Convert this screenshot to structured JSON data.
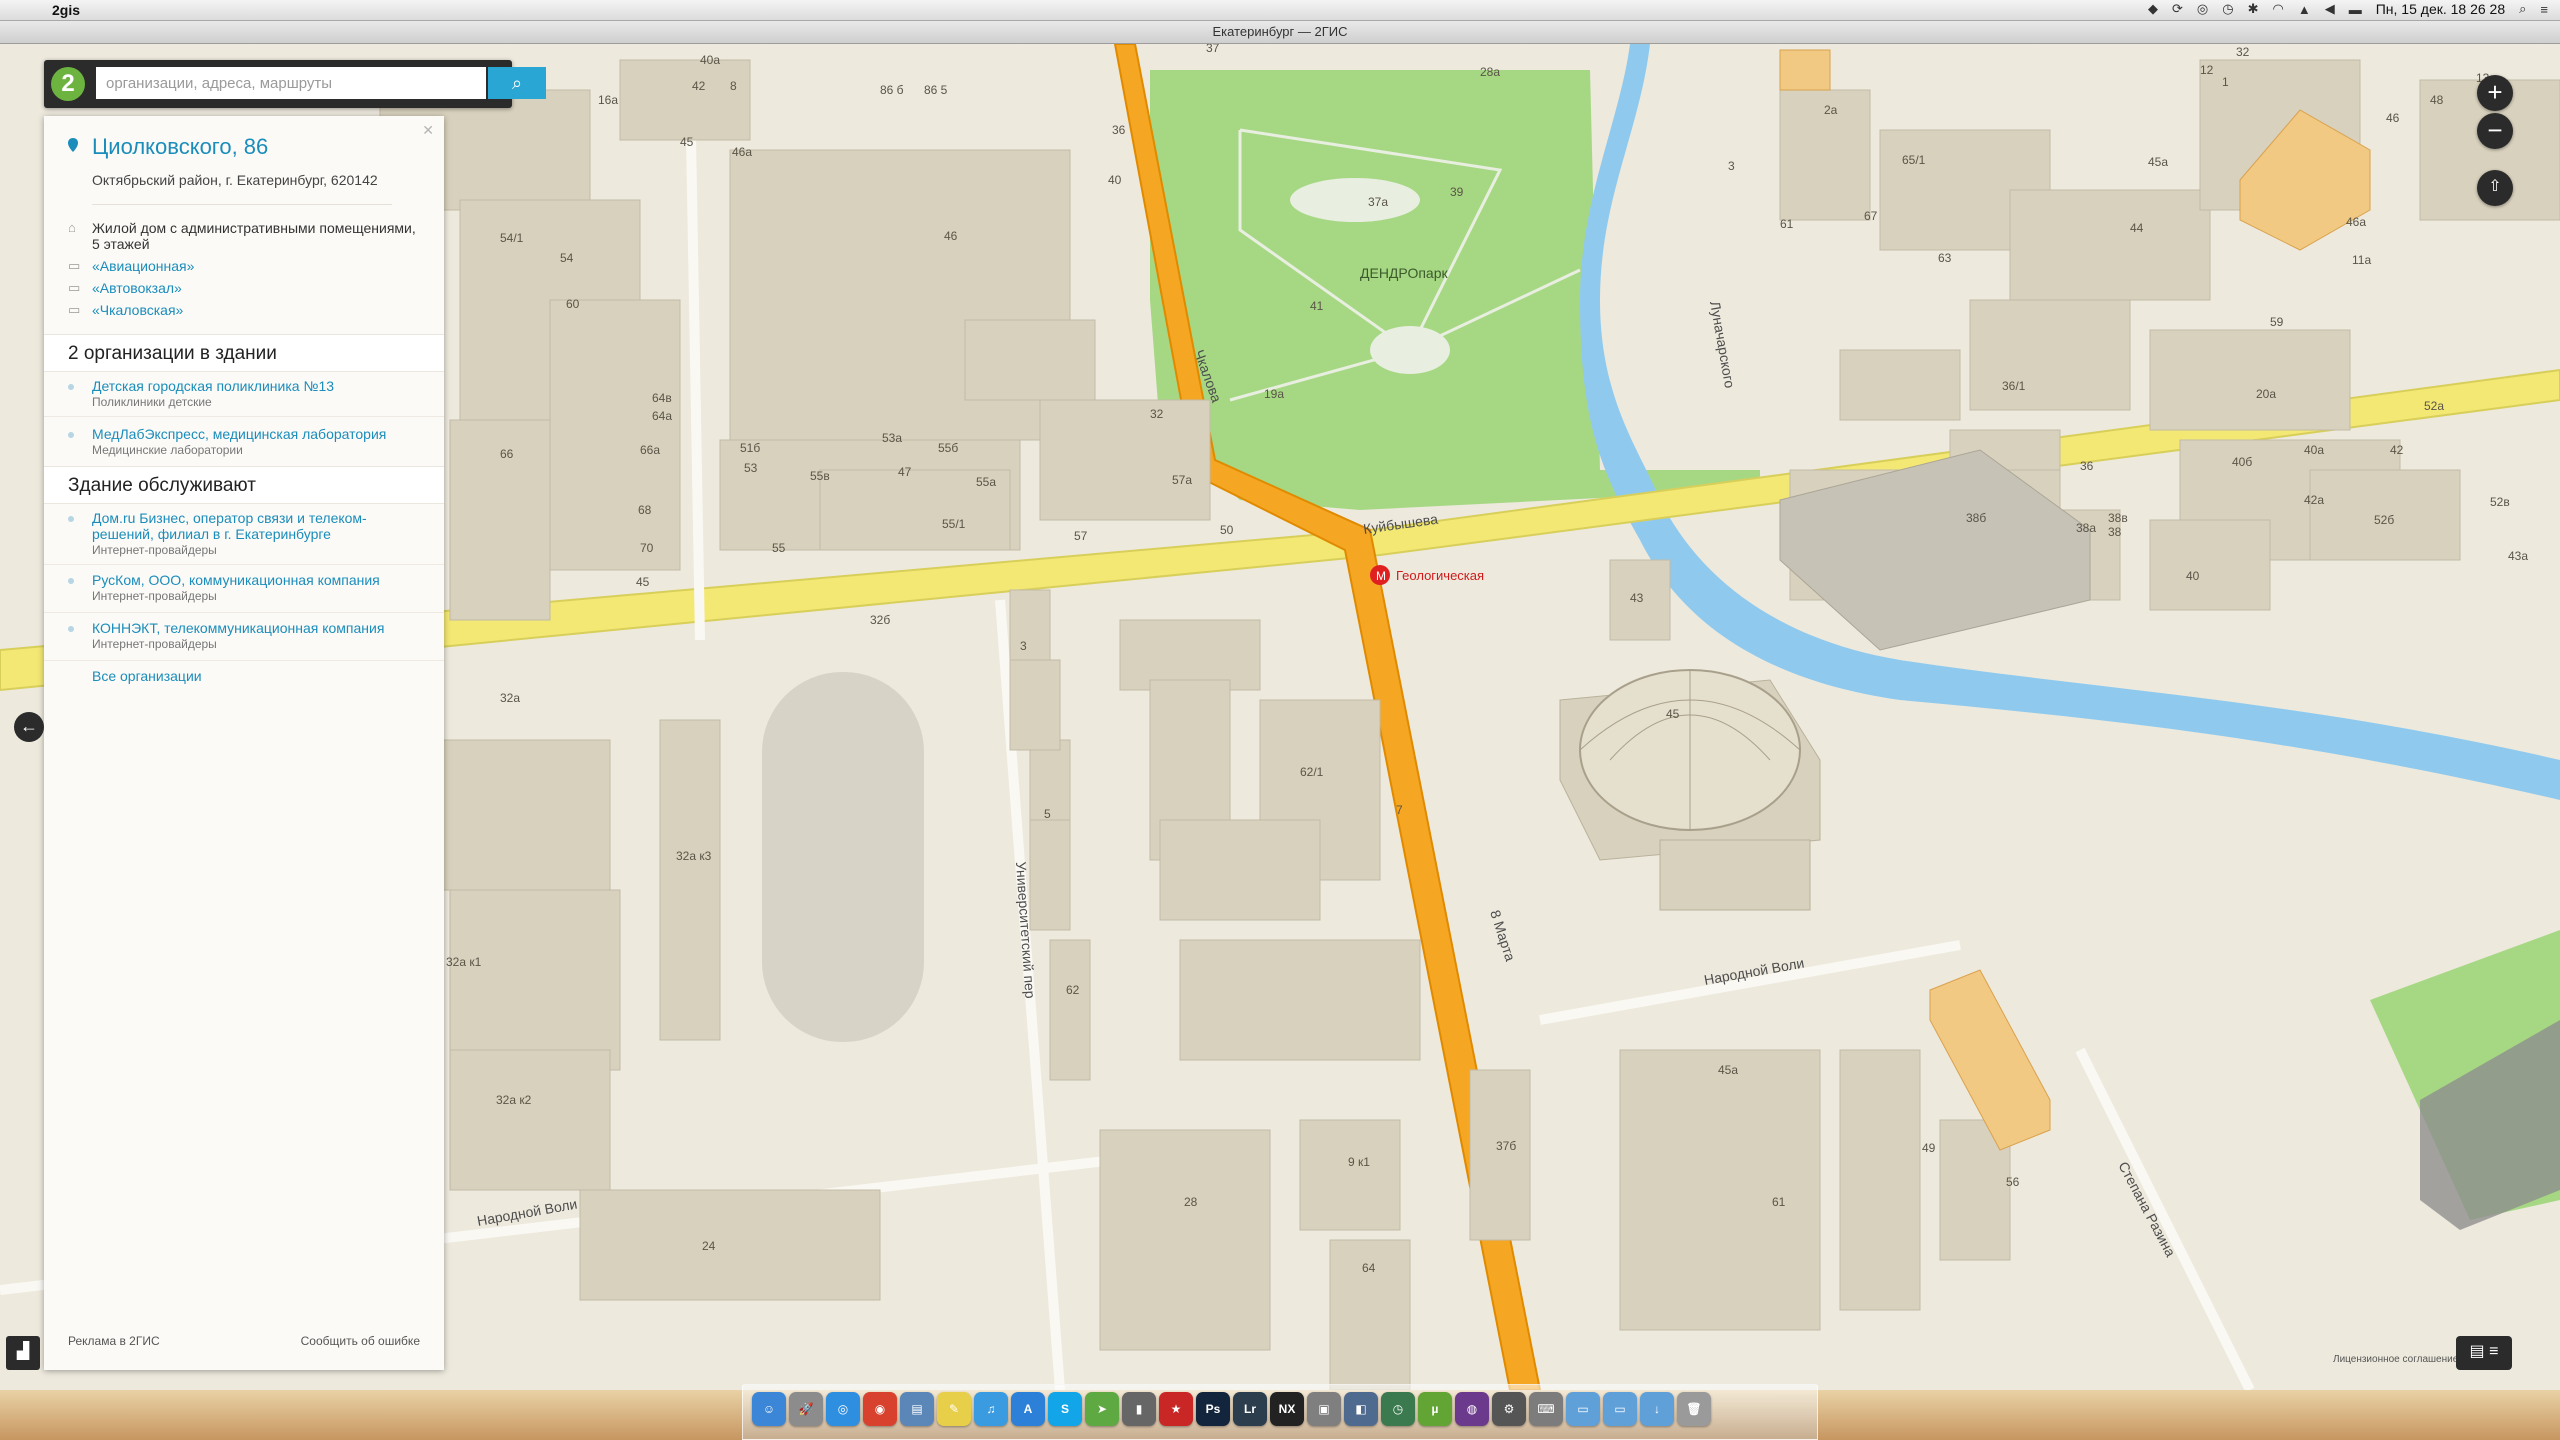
{
  "menubar": {
    "app_name": "2gis",
    "clock": "Пн, 15 дек.  18 26 28",
    "status_icons": [
      "dropbox-icon",
      "sync-icon",
      "eye-icon",
      "history-icon",
      "bluetooth-icon",
      "wifi-icon",
      "airplay-icon",
      "volume-icon",
      "flag-icon",
      "search-icon",
      "list-icon"
    ]
  },
  "window": {
    "title": "Екатеринбург — 2ГИС"
  },
  "search": {
    "placeholder": "организации, адреса, маршруты",
    "logo": "2"
  },
  "card": {
    "address": "Циолковского, 86",
    "district": "Октябрьский район, г. Екатеринбург, 620142",
    "building": "Жилой дом с административными помещениями, 5 этажей",
    "stops": [
      {
        "name": "«Авиационная»",
        "icon": "bus-stop-icon"
      },
      {
        "name": "«Автовокзал»",
        "icon": "tram-stop-icon"
      },
      {
        "name": "«Чкаловская»",
        "icon": "trolley-stop-icon"
      }
    ],
    "orgs_header": "2 организации в здании",
    "orgs": [
      {
        "name": "Детская городская поликлиника №13",
        "cat": "Поликлиники детские"
      },
      {
        "name": "МедЛабЭкспресс, медицинская лаборатория",
        "cat": "Медицинские лаборатории"
      }
    ],
    "service_header": "Здание обслуживают",
    "services": [
      {
        "name": "Дом.ru Бизнес, оператор связи и телеком-решений, филиал в г. Екатеринбурге",
        "cat": "Интернет-провайдеры"
      },
      {
        "name": "РусКом, ООО, коммуникационная компания",
        "cat": "Интернет-провайдеры"
      },
      {
        "name": "КОННЭКТ, телекоммуникационная компания",
        "cat": "Интернет-провайдеры"
      }
    ],
    "all_orgs": "Все организации",
    "footer_ad": "Реклама в 2ГИС",
    "footer_report": "Сообщить об ошибке"
  },
  "map": {
    "metro": "Геологическая",
    "park": "ДЕНДРОпарк",
    "streets": [
      "Народной Воли",
      "Народной Воли",
      "8 Марта",
      "Университетский пер",
      "Степана Разина",
      "Куйбышева",
      "Чкалова",
      "Луначарского"
    ],
    "license": "Лицензионное соглашение",
    "house_numbers": [
      "37",
      "8",
      "86 б",
      "86 5",
      "40а",
      "42",
      "16а",
      "46а",
      "46",
      "45",
      "54/1",
      "54",
      "60",
      "64в",
      "64а",
      "66а",
      "66",
      "68",
      "70",
      "45",
      "32а",
      "32б",
      "32а к3",
      "32а к1",
      "32а к2",
      "24",
      "51б",
      "53",
      "53а",
      "55б",
      "55в",
      "47",
      "55а",
      "55",
      "55/1",
      "57",
      "57а",
      "50",
      "32",
      "3",
      "5",
      "62",
      "62/1",
      "7",
      "28",
      "9 к1",
      "64",
      "37б",
      "37а",
      "39",
      "41",
      "19а",
      "28а",
      "2а",
      "3",
      "61",
      "36/1",
      "36",
      "38б",
      "38в",
      "38",
      "38а",
      "40",
      "40б",
      "40а",
      "42а",
      "42",
      "52а",
      "52б",
      "52в",
      "43а",
      "43",
      "45",
      "45а",
      "49",
      "61",
      "56",
      "65/1",
      "67",
      "44",
      "45а",
      "46а",
      "46",
      "48",
      "59",
      "11а",
      "12",
      "1",
      "32",
      "36",
      "40",
      "63",
      "20а",
      "13"
    ],
    "colors": {
      "background": "#ede9dd",
      "park": "#a6d883",
      "river": "#8fcaee",
      "main_road": "#f5a623",
      "road": "#f3e873",
      "building": "#d8d1bd"
    }
  },
  "controls": {
    "zoom_in": "+",
    "zoom_out": "−",
    "back_arrow": "←"
  },
  "dock": {
    "apps": [
      {
        "name": "finder",
        "color": "#3b86d6",
        "glyph": "☺"
      },
      {
        "name": "launchpad",
        "color": "#8c8c8c",
        "glyph": "🚀"
      },
      {
        "name": "safari",
        "color": "#2e8ee0",
        "glyph": "◎"
      },
      {
        "name": "chrome",
        "color": "#d9412f",
        "glyph": "◉"
      },
      {
        "name": "preview",
        "color": "#5b86b8",
        "glyph": "▤"
      },
      {
        "name": "notes",
        "color": "#e8cf4a",
        "glyph": "✎"
      },
      {
        "name": "itunes",
        "color": "#3a9be0",
        "glyph": "♫"
      },
      {
        "name": "app-store",
        "color": "#2c80d8",
        "glyph": "A"
      },
      {
        "name": "skype",
        "color": "#12a5e8",
        "glyph": "S"
      },
      {
        "name": "maps",
        "color": "#5fa942",
        "glyph": "➤"
      },
      {
        "name": "lamp",
        "color": "#666666",
        "glyph": "▮"
      },
      {
        "name": "news",
        "color": "#c92626",
        "glyph": "★"
      },
      {
        "name": "photoshop",
        "color": "#13253d",
        "glyph": "Ps"
      },
      {
        "name": "lightroom",
        "color": "#2c3d4e",
        "glyph": "Lr"
      },
      {
        "name": "nx2",
        "color": "#222222",
        "glyph": "NX"
      },
      {
        "name": "photos",
        "color": "#7f7f7f",
        "glyph": "▣"
      },
      {
        "name": "iphoto",
        "color": "#4f6a8f",
        "glyph": "◧"
      },
      {
        "name": "time-machine",
        "color": "#3b7a4e",
        "glyph": "◷"
      },
      {
        "name": "utorrent",
        "color": "#62a534",
        "glyph": "µ"
      },
      {
        "name": "tor",
        "color": "#6c3a8c",
        "glyph": "◍"
      },
      {
        "name": "game",
        "color": "#555555",
        "glyph": "⚙"
      },
      {
        "name": "keyboard",
        "color": "#7c7c7c",
        "glyph": "⌨"
      },
      {
        "name": "folder",
        "color": "#5fa0d8",
        "glyph": "▭"
      },
      {
        "name": "documents",
        "color": "#5fa0d8",
        "glyph": "▭"
      },
      {
        "name": "downloads",
        "color": "#5fa0d8",
        "glyph": "↓"
      },
      {
        "name": "trash",
        "color": "#9a9a9a",
        "glyph": "🗑"
      }
    ]
  }
}
